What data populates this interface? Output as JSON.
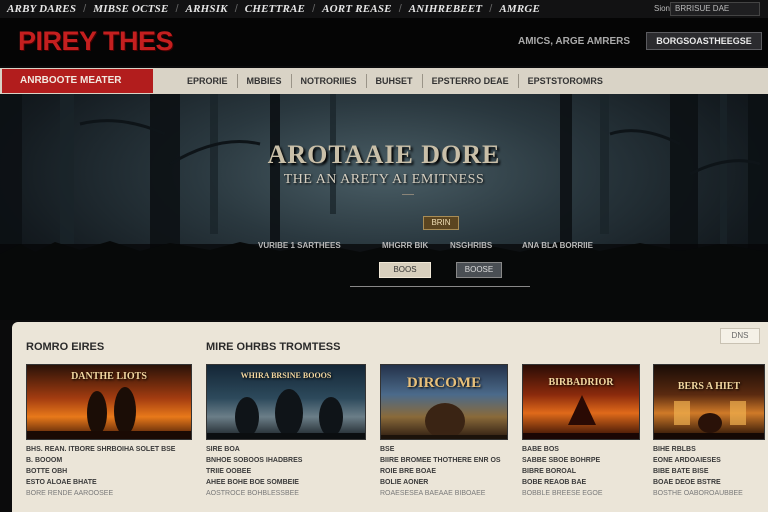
{
  "topnav": {
    "items": [
      "ARBY DARES",
      "MIBSE OCTSE",
      "ARHSIK",
      "CHETTRAE",
      "AORT REASE",
      "ANIHREBEET",
      "AMRGE"
    ],
    "signin": "Sion",
    "search_value": "BRRISUE DAE"
  },
  "header": {
    "logo": "PIREY THES",
    "links": "AMICS, ARGE AMRERS",
    "button": "BORGSOASTHEEGSE"
  },
  "subnav": {
    "active": "ANRBOOTE MEATER",
    "items": [
      "EPRORIE",
      "MBBIES",
      "NOTRORIIES",
      "BUHSET",
      "EPSTERRO DEAE",
      "EPSTSTOROMRS"
    ]
  },
  "hero": {
    "title": "AROTAAIE DORE",
    "subtitle": "THE AN ARETY AI EMITNESS",
    "badge": "BRIN",
    "meta": [
      "VURIBE 1 SARTHEES",
      "MHGRR BIK",
      "NSGHRIBS",
      "ANA BLA BORRIIE"
    ],
    "btn_primary": "BOOS",
    "btn_secondary": "BOOSE"
  },
  "panel": {
    "section_left": "ROMRO EIRES",
    "section_right": "MIRE OHRBS TROMTESS",
    "filter_button": "DNS",
    "cards": [
      {
        "thumb_title": "DANTHE LIOTS",
        "lines": [
          "BHS. REAN. ITBORE SHRBOIHA SOLET BSE",
          "B. BOOOM",
          "BOTTE OBH",
          "ESTO ALOAE BHATE",
          "BORE RENDE AAROOSEE"
        ]
      },
      {
        "thumb_title": "WHIRA BRSINE BOOOS",
        "lines": [
          "SIRE BOA",
          "BNHOE SOBOOS IHADBRES",
          "TRIIE OOBEE",
          "AHEE BOHE BOE SOMBEIE",
          "AOSTROCE BOHBLESSBEE"
        ]
      },
      {
        "thumb_title": "DIRCOME",
        "lines": [
          "BSE",
          "BIIRE BROMEE THOTHERE ENR OS",
          "ROIE BRE BOAE",
          "BOLIE AONER",
          "ROAESESEA BAEAAE BIBOAEE"
        ]
      },
      {
        "thumb_title": "BIRBADRIOR",
        "lines": [
          "BABE BOS",
          "SABBE SBOE BOHRPE",
          "BIBRE BOROAL",
          "BOBE REAOB BAE",
          "BOBBLE BREESE EGOE"
        ]
      },
      {
        "thumb_title": "BERS A HIET",
        "lines": [
          "BIHE RBLBS",
          "EONE ARDOAIESES",
          "BIBE BATE BISE",
          "BOAE DEOE BSTRE",
          "BOSTHE OABOROAUBBEE"
        ]
      }
    ]
  },
  "colors": {
    "brand_red": "#c41f1f",
    "nav_red": "#b21d1d",
    "panel_bg": "#ebe5d8",
    "hero_fog": "#4a5e66"
  }
}
